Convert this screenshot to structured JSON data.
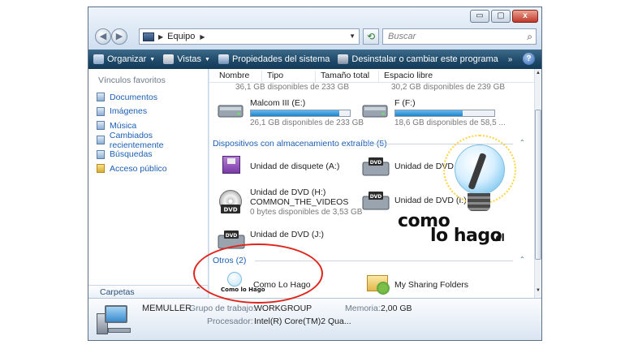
{
  "window": {
    "caption_buttons": [
      "▭",
      "▢",
      "x"
    ]
  },
  "address_bar": {
    "path": "Equipo",
    "search_placeholder": "Buscar"
  },
  "command_bar": {
    "items": [
      {
        "label": "Organizar",
        "icon": "organize-icon",
        "has_menu": true
      },
      {
        "label": "Vistas",
        "icon": "views-icon",
        "has_menu": true
      },
      {
        "label": "Propiedades del sistema",
        "icon": "system-properties-icon",
        "has_menu": false
      },
      {
        "label": "Desinstalar o cambiar este programa",
        "icon": "uninstall-icon",
        "has_menu": false
      }
    ],
    "overflow": "»",
    "help": "?"
  },
  "nav_pane": {
    "title": "Vínculos favoritos",
    "items": [
      {
        "label": "Documentos",
        "icon": "documents-icon"
      },
      {
        "label": "Imágenes",
        "icon": "pictures-icon"
      },
      {
        "label": "Música",
        "icon": "music-icon"
      },
      {
        "label": "Cambiados recientemente",
        "icon": "recent-icon"
      },
      {
        "label": "Búsquedas",
        "icon": "searches-icon"
      },
      {
        "label": "Acceso público",
        "icon": "public-folder-icon"
      }
    ],
    "folders_label": "Carpetas"
  },
  "columns": [
    "Nombre",
    "Tipo",
    "Tamaño total",
    "Espacio libre"
  ],
  "hard_drives": {
    "top_partial": [
      {
        "free_text": "36,1 GB disponibles de 233 GB"
      },
      {
        "free_text": "30,2 GB disponibles de 239 GB"
      }
    ],
    "items": [
      {
        "name": "Malcom III (E:)",
        "free_text": "26,1 GB disponibles de 233 GB",
        "used_fraction": 0.89
      },
      {
        "name": "F (F:)",
        "free_text": "18,6 GB disponibles de 58,5 ...",
        "used_fraction": 0.68
      }
    ]
  },
  "removable_group": {
    "title": "Dispositivos con almacenamiento extraíble (5)",
    "items": [
      {
        "name": "Unidad de disquete (A:)",
        "icon": "floppy-drive-icon"
      },
      {
        "name": "Unidad de DVD RW (G:)",
        "icon": "dvd-rw-drive-icon",
        "badge": "DVD"
      },
      {
        "name_line1": "Unidad de DVD (H:)",
        "name_line2": "COMMON_THE_VIDEOS",
        "free_text": "0 bytes disponibles de 3,53 GB",
        "icon": "dvd-disc-icon",
        "badge": "DVD"
      },
      {
        "name": "Unidad de DVD (I:)",
        "icon": "dvd-drive-icon",
        "badge": "DVD"
      },
      {
        "name": "Unidad de DVD (J:)",
        "icon": "dvd-drive-icon",
        "badge": "DVD"
      }
    ]
  },
  "others_group": {
    "title": "Otros (2)",
    "items": [
      {
        "name": "Como Lo Hago",
        "icon": "como-lo-hago-icon",
        "icon_text": "Como lo Hago"
      },
      {
        "name": "My Sharing Folders",
        "icon": "sharing-folders-icon"
      }
    ]
  },
  "brand": {
    "line1": "como",
    "line2": "lo hago",
    "suffix": ".cl"
  },
  "details": {
    "computer_name": "MEMULLER",
    "workgroup_label": "Grupo de trabajo:",
    "workgroup_value": "WORKGROUP",
    "memory_label": "Memoria:",
    "memory_value": "2,00 GB",
    "processor_label": "Procesador:",
    "processor_value": "Intel(R) Core(TM)2 Qua..."
  },
  "colors": {
    "accent_link": "#1b5fb4",
    "command_bar": "#1f4a6a",
    "highlight_circle": "#e0241b",
    "bar_fill": "#1e84c8"
  }
}
